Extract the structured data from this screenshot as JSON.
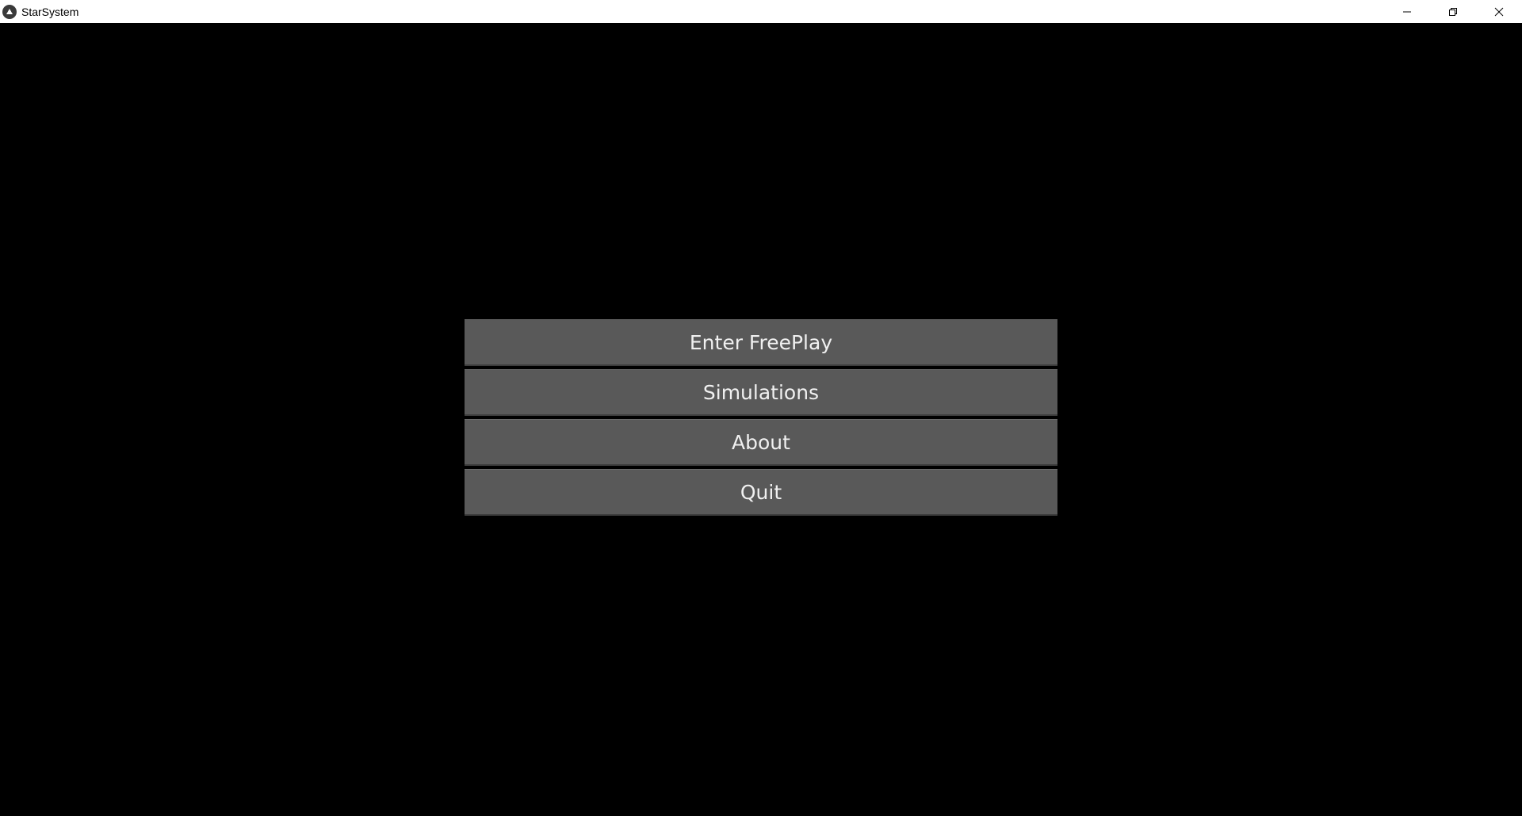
{
  "window": {
    "title": "StarSystem",
    "icon": "kivy-logo-icon",
    "controls": {
      "minimize": "minimize-icon",
      "maximize": "restore-icon",
      "close": "close-icon"
    }
  },
  "menu": {
    "items": [
      {
        "label": "Enter FreePlay"
      },
      {
        "label": "Simulations"
      },
      {
        "label": "About"
      },
      {
        "label": "Quit"
      }
    ]
  },
  "colors": {
    "background": "#000000",
    "button": "#595959",
    "button_text": "#f0f0f0",
    "titlebar": "#ffffff"
  }
}
